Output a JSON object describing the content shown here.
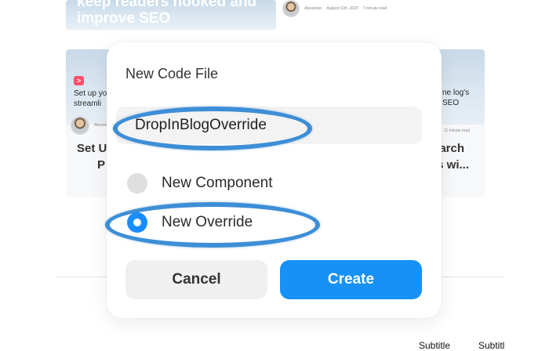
{
  "background": {
    "top_card_title": "keep readers hooked and improve SEO",
    "top_meta": {
      "author": "Alexander",
      "date": "August 11th, 2025",
      "read_time": "7 minute read"
    },
    "left_card_badge": ">",
    "left_card_image_text": "Set up yo streamli",
    "left_card_author": "Alexand",
    "left_card_title_line1": "Set U",
    "left_card_title_line2": "P",
    "right_card_image_text": "ne log's SEO",
    "right_card_read_time": "11 minute read",
    "right_card_title_line1": "earch",
    "right_card_title_line2": "gs wi...",
    "footer_subtitle_1": "Subtitle",
    "footer_subtitle_2": "Subtitl"
  },
  "dialog": {
    "title": "New Code File",
    "name_value": "DropInBlogOverride",
    "options": [
      {
        "label": "New Component",
        "selected": false
      },
      {
        "label": "New Override",
        "selected": true
      }
    ],
    "cancel_label": "Cancel",
    "create_label": "Create"
  },
  "colors": {
    "accent": "#1591f7",
    "annotation": "#3d8ed6"
  }
}
